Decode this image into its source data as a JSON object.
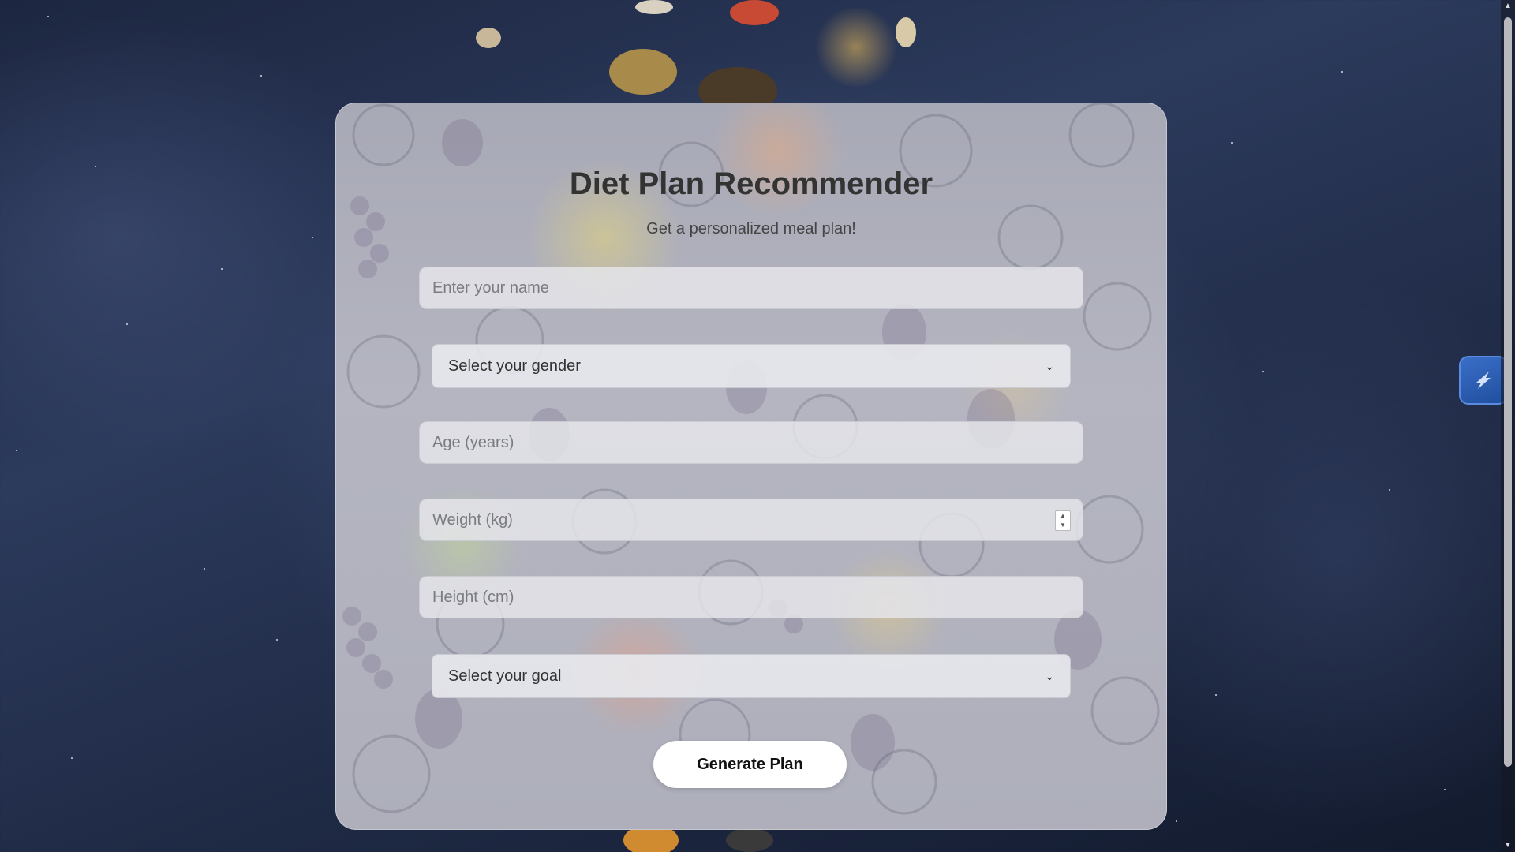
{
  "header": {
    "title": "Diet Plan Recommender",
    "subtitle": "Get a personalized meal plan!"
  },
  "form": {
    "name_placeholder": "Enter your name",
    "gender_select": "Select your gender",
    "age_placeholder": "Age (years)",
    "weight_placeholder": "Weight (kg)",
    "height_placeholder": "Height (cm)",
    "goal_select": "Select your goal",
    "submit_label": "Generate Plan"
  },
  "icons": {
    "select_arrow": "chevron-down-icon",
    "extension": "extension-icon",
    "spinner_up": "triangle-up-icon",
    "spinner_down": "triangle-down-icon"
  },
  "colors": {
    "button_bg": "#ffffff",
    "title": "#333333",
    "extension_accent": "#2f63b8"
  }
}
